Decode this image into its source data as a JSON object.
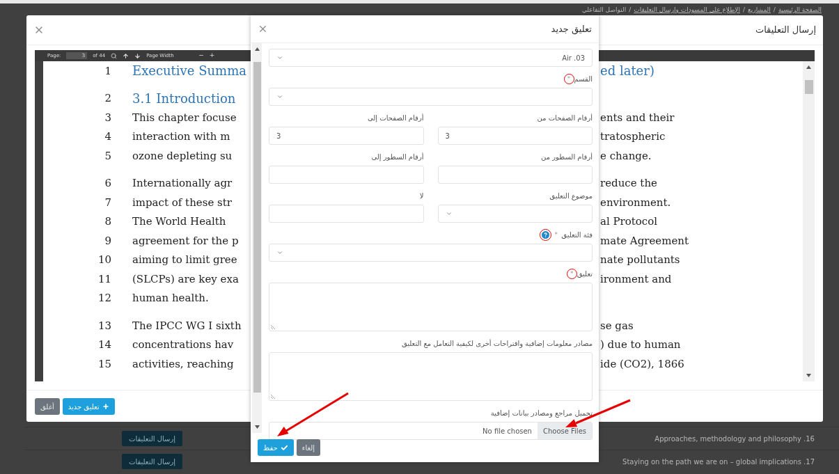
{
  "breadcrumb": [
    "الصفحة الرئيسية",
    "المشاريع",
    "الإطلاع على المسودات وإرسال التعليقات",
    "التواصل التفاعلي"
  ],
  "breadcrumb_separator": "/",
  "background_rows": [
    {
      "title": "Approaches, methodology and philosophy .16",
      "button": "إرسال التعليقات"
    },
    {
      "title": "Staying on the path we are on – global implications .17",
      "button": "إرسال التعليقات"
    }
  ],
  "comments_modal": {
    "title": "إرسال التعليقات",
    "viewer": {
      "page_label": "Page:",
      "page": "3",
      "page_count": "of 44",
      "zoom": "Page Width",
      "zoom_out": "−",
      "zoom_in": "+",
      "lines": [
        {
          "number": "1",
          "left": "Executive Summa",
          "right": "ed later)",
          "kind": "heading",
          "paragraph_start": false
        },
        {
          "number": "2",
          "left": "3.1   Introduction",
          "kind": "heading",
          "paragraph_start": true
        },
        {
          "number": "3",
          "left": "This chapter focuse",
          "right": "ents and their",
          "kind": "body",
          "paragraph_start": false
        },
        {
          "number": "4",
          "left": "interaction with m",
          "right": "tratospheric",
          "kind": "body",
          "paragraph_start": false
        },
        {
          "number": "5",
          "left": "ozone depleting su",
          "right": "e change.",
          "kind": "body",
          "paragraph_start": false
        },
        {
          "number": "6",
          "left": "Internationally agr",
          "right": "reduce the",
          "kind": "body",
          "paragraph_start": true
        },
        {
          "number": "7",
          "left": "impact of these str",
          "right": "environment.",
          "kind": "body",
          "paragraph_start": false
        },
        {
          "number": "8",
          "left": "The World Health",
          "right": "al Protocol",
          "kind": "body",
          "paragraph_start": false
        },
        {
          "number": "9",
          "left": "agreement for the p",
          "right": "mate Agreement",
          "kind": "body",
          "paragraph_start": false
        },
        {
          "number": "10",
          "left": "aiming to limit gree",
          "right": "nate pollutants",
          "kind": "body",
          "paragraph_start": false
        },
        {
          "number": "11",
          "left": "(SLCPs) are key exa",
          "right": "ironment and",
          "kind": "body",
          "paragraph_start": false
        },
        {
          "number": "12",
          "left": "human health.",
          "kind": "body",
          "paragraph_start": false
        },
        {
          "number": "13",
          "left": "The IPCC WG I sixth",
          "right": "se gas",
          "kind": "body",
          "paragraph_start": true
        },
        {
          "number": "14",
          "left": "concentrations hav",
          "right": ") due to human",
          "kind": "body",
          "paragraph_start": false
        },
        {
          "number": "15",
          "left": "activities, reaching",
          "right": "ide (CO2), 1866",
          "kind": "body",
          "paragraph_start": false
        }
      ]
    },
    "buttons": [
      {
        "label": "تعليق جديد",
        "kind": "primary"
      },
      {
        "label": "أغلق",
        "kind": "secondary"
      }
    ]
  },
  "new_comment_modal": {
    "title": "تعليق جديد",
    "required_mark": "*",
    "rows": [
      [
        {
          "kind": "select",
          "value": "Air .03"
        }
      ],
      [
        {
          "kind": "select",
          "label": "القسم",
          "required": true,
          "highlighted": true
        }
      ],
      [
        {
          "kind": "text",
          "label": "أرقام الصفحات من",
          "value": "3"
        },
        {
          "kind": "text",
          "label": "أرقام الصفحات إلى",
          "value": "3"
        }
      ],
      [
        {
          "kind": "text",
          "label": "أرقام السطور من"
        },
        {
          "kind": "text",
          "label": "أرقام السطور إلى"
        }
      ],
      [
        {
          "kind": "select",
          "label": "موضوع التعليق"
        },
        {
          "kind": "text",
          "label": "لا"
        }
      ],
      [
        {
          "kind": "select",
          "label": "فئة التعليق",
          "required": true,
          "help": true,
          "highlighted": true
        }
      ],
      [
        {
          "kind": "textarea",
          "label": "تعليق",
          "required": true,
          "highlighted": true
        }
      ],
      [
        {
          "kind": "textarea",
          "label": "مصادر معلومات إضافية واقتراحات أخرى لكيفية التعامل مع التعليق"
        }
      ],
      [
        {
          "kind": "file",
          "label": "تحميل مراجع ومصادر بيانات إضافية",
          "button": "Choose Files",
          "status": "No file chosen"
        }
      ]
    ],
    "buttons": [
      {
        "label": "إلغاء",
        "kind": "secondary"
      },
      {
        "label": "حفظ",
        "kind": "primary"
      }
    ]
  }
}
